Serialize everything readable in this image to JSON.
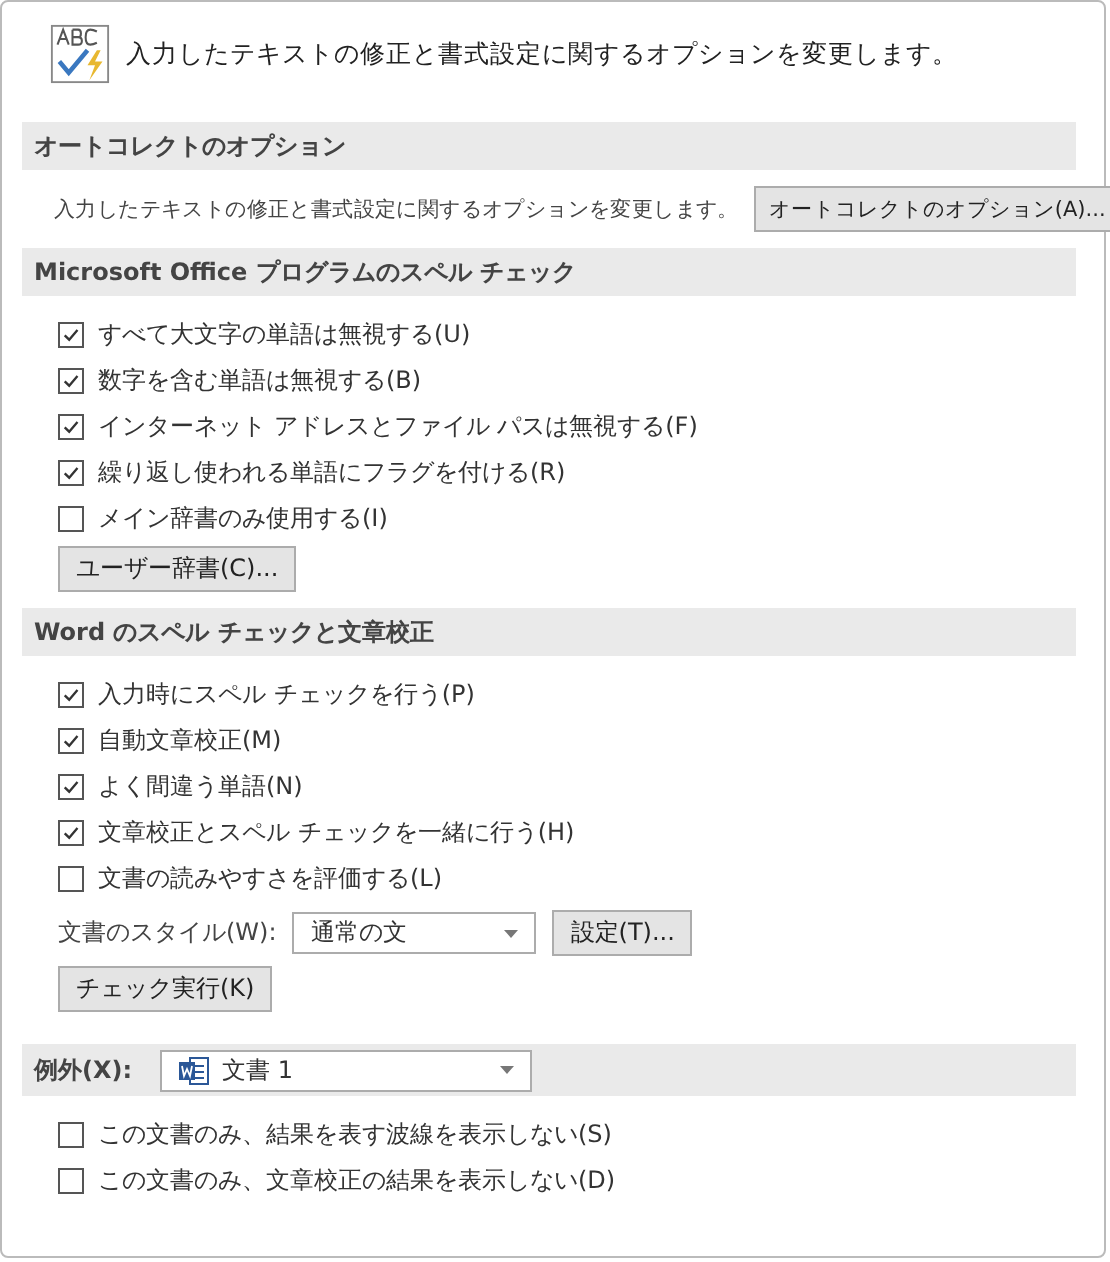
{
  "header": {
    "text": "入力したテキストの修正と書式設定に関するオプションを変更します。"
  },
  "autocorrect": {
    "title": "オートコレクトのオプション",
    "description": "入力したテキストの修正と書式設定に関するオプションを変更します。",
    "button": "オートコレクトのオプション(A)..."
  },
  "office_spelling": {
    "title": "Microsoft Office プログラムのスペル チェック",
    "options": [
      {
        "label": "すべて大文字の単語は無視する(U)",
        "checked": true
      },
      {
        "label": "数字を含む単語は無視する(B)",
        "checked": true
      },
      {
        "label": "インターネット アドレスとファイル パスは無視する(F)",
        "checked": true
      },
      {
        "label": "繰り返し使われる単語にフラグを付ける(R)",
        "checked": true
      },
      {
        "label": "メイン辞書のみ使用する(I)",
        "checked": false
      }
    ],
    "button": "ユーザー辞書(C)..."
  },
  "word_proofing": {
    "title": "Word のスペル チェックと文章校正",
    "options": [
      {
        "label": "入力時にスペル チェックを行う(P)",
        "checked": true
      },
      {
        "label": "自動文章校正(M)",
        "checked": true
      },
      {
        "label": "よく間違う単語(N)",
        "checked": true
      },
      {
        "label": "文章校正とスペル チェックを一緒に行う(H)",
        "checked": true
      },
      {
        "label": "文書の読みやすさを評価する(L)",
        "checked": false
      }
    ],
    "style_label": "文書のスタイル(W):",
    "style_value": "通常の文",
    "settings_button": "設定(T)...",
    "check_button": "チェック実行(K)"
  },
  "exceptions": {
    "label": "例外(X):",
    "document": "文書 1",
    "options": [
      {
        "label": "この文書のみ、結果を表す波線を表示しない(S)",
        "checked": false
      },
      {
        "label": "この文書のみ、文章校正の結果を表示しない(D)",
        "checked": false
      }
    ]
  }
}
